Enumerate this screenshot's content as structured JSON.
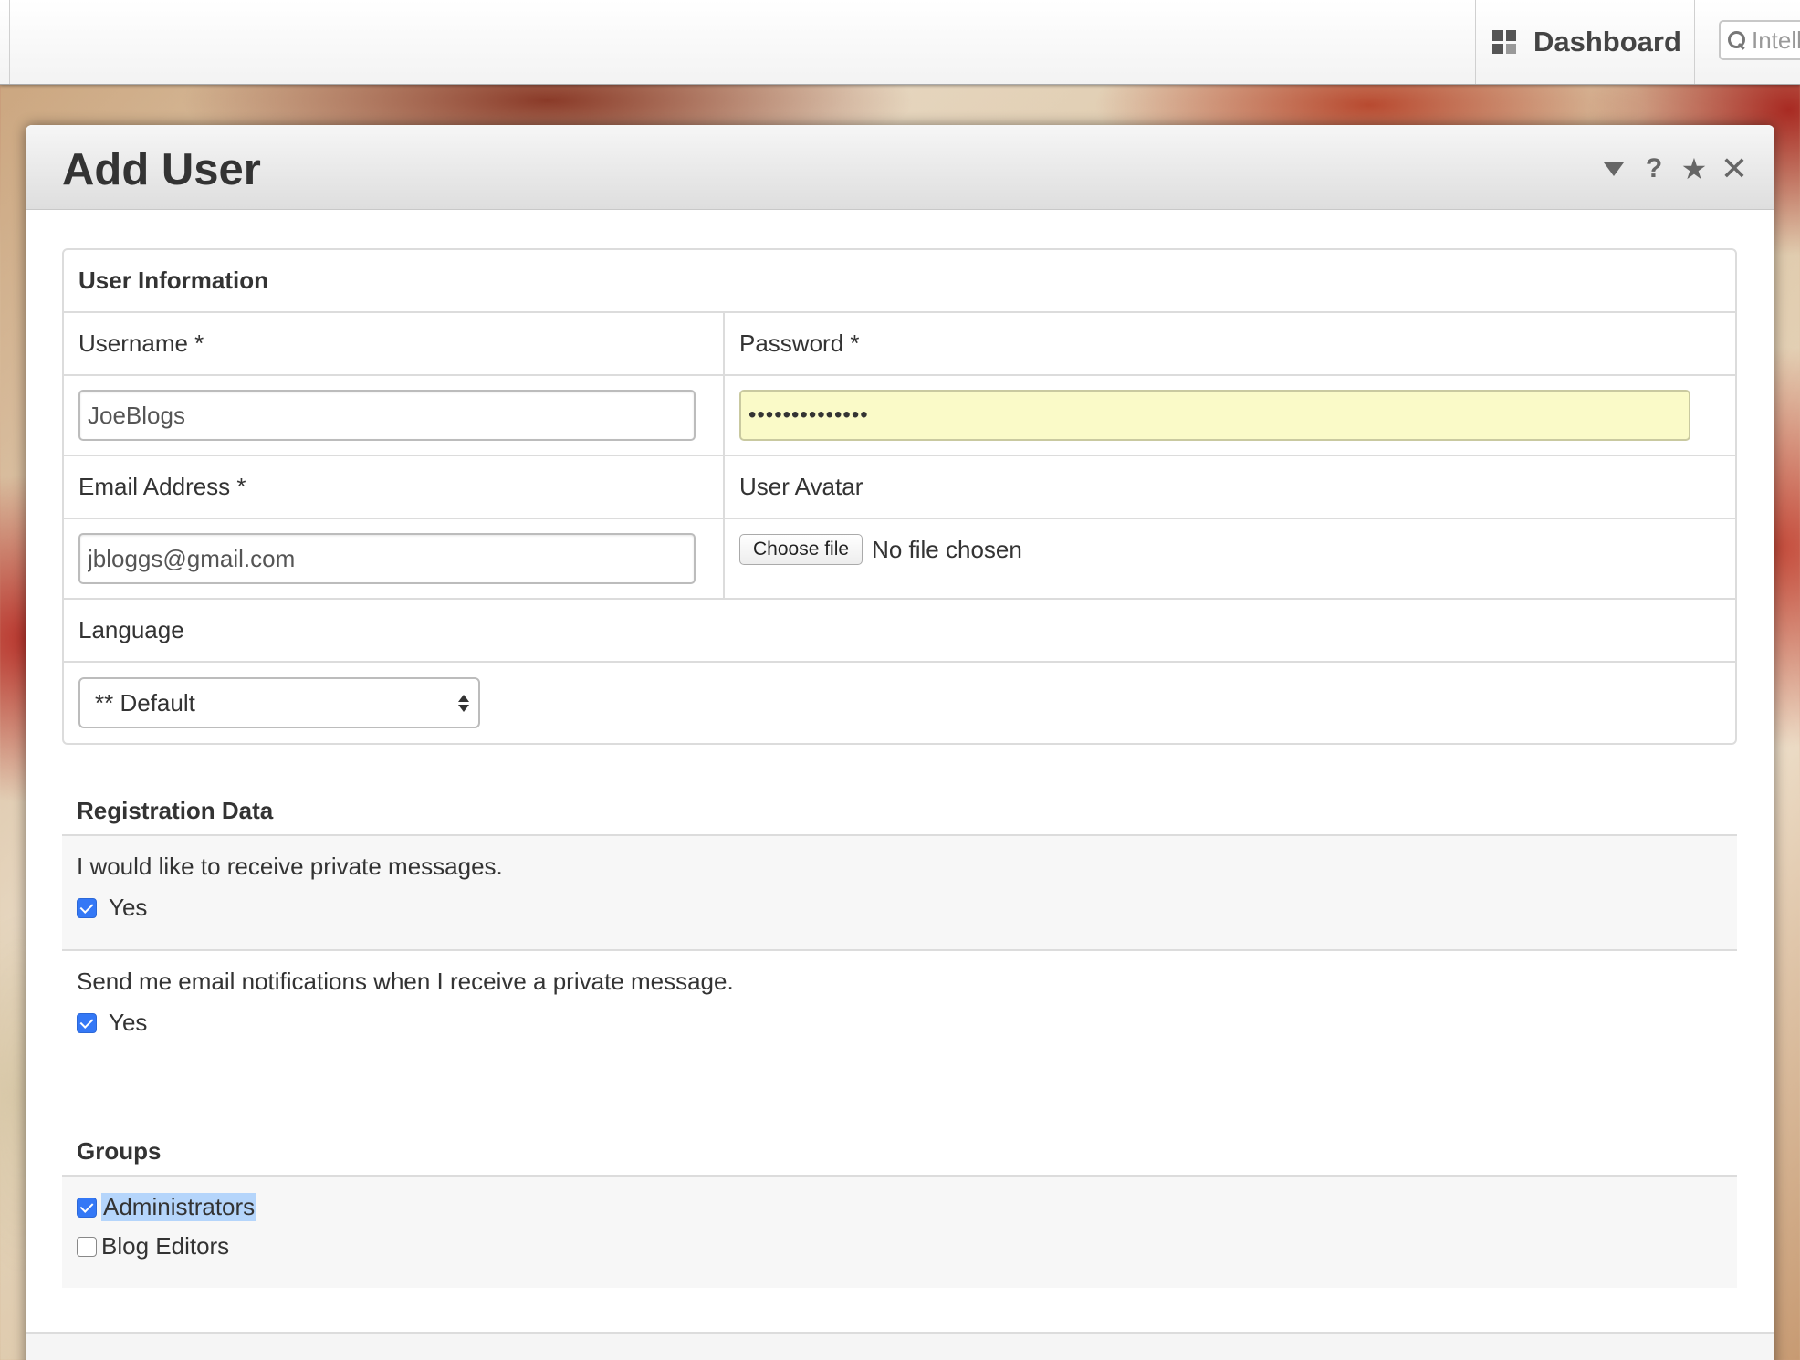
{
  "toolbar": {
    "dashboard_label": "Dashboard",
    "search_placeholder": "Intelli"
  },
  "dialog": {
    "title": "Add User",
    "icons": [
      "chevron-down-icon",
      "help-icon",
      "star-icon",
      "close-icon"
    ],
    "help_glyph": "?",
    "star_glyph": "★",
    "close_glyph": "✕"
  },
  "user_info": {
    "title": "User Information",
    "username_label": "Username *",
    "username_value": "JoeBlogs",
    "password_label": "Password *",
    "password_value": "••••••••••••••",
    "email_label": "Email Address *",
    "email_value": "jbloggs@gmail.com",
    "avatar_label": "User Avatar",
    "choose_file_label": "Choose file",
    "file_status": "No file chosen",
    "language_label": "Language",
    "language_value": "** Default"
  },
  "registration": {
    "title": "Registration Data",
    "q1": "I would like to receive private messages.",
    "q1_option": "Yes",
    "q1_checked": true,
    "q2": "Send me email notifications when I receive a private message.",
    "q2_option": "Yes",
    "q2_checked": true
  },
  "groups": {
    "title": "Groups",
    "items": [
      {
        "label": "Administrators",
        "checked": true
      },
      {
        "label": "Blog Editors",
        "checked": false
      }
    ]
  },
  "colors": {
    "checkbox_accent": "#3478f6",
    "password_fill": "#fafac8",
    "selection_highlight": "#b5d5fb"
  }
}
